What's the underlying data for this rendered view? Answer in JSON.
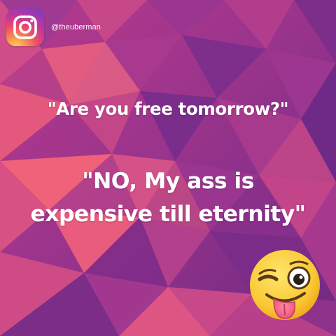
{
  "account": {
    "platform_icon": "instagram-icon",
    "handle": "@theuberman"
  },
  "quotes": {
    "question": "\"Are you free tomorrow?\"",
    "answer_line1": "\"NO, My ass is",
    "answer_line2": "expensive till eternity\""
  },
  "decoration": {
    "emoji": "winking-face-with-tongue-icon"
  },
  "colors": {
    "bg_purple": "#7a2a86",
    "bg_pink": "#e2557f",
    "text": "#ffffff",
    "emoji_yellow": "#f7c235"
  }
}
